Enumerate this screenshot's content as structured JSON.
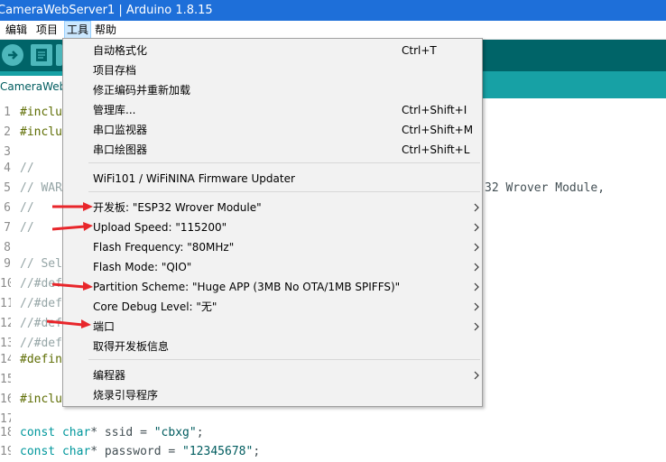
{
  "window": {
    "title": "CameraWebServer1 | Arduino 1.8.15"
  },
  "menubar": {
    "items": [
      "编辑",
      "项目",
      "工具",
      "帮助"
    ]
  },
  "tab": {
    "label": "CameraWebServer"
  },
  "editor": {
    "lines": [
      {
        "n": "1",
        "code": "#inclu"
      },
      {
        "n": "2",
        "code": "#inclu"
      },
      {
        "n": "3",
        "code": ""
      },
      {
        "n": "4",
        "code": "//"
      },
      {
        "n": "5",
        "code": "// WAR"
      },
      {
        "n": "6",
        "code": "//"
      },
      {
        "n": "7",
        "code": "//"
      },
      {
        "n": "8",
        "code": ""
      },
      {
        "n": "9",
        "code": "// Sel"
      },
      {
        "n": "10",
        "code": "//#def"
      },
      {
        "n": "11",
        "code": "//#def"
      },
      {
        "n": "12",
        "code": "//#def"
      },
      {
        "n": "13",
        "code": "//#def"
      },
      {
        "n": "14",
        "code": "#defin"
      },
      {
        "n": "15",
        "code": ""
      },
      {
        "n": "16",
        "code": "#inclu"
      },
      {
        "n": "17",
        "code": ""
      },
      {
        "n": "18",
        "code_parts": [
          "const",
          " ",
          "char",
          "* ssid = ",
          "\"cbxg\"",
          ";"
        ]
      },
      {
        "n": "19",
        "code_parts": [
          "const",
          " ",
          "char",
          "* password = ",
          "\"12345678\"",
          ";"
        ]
      }
    ],
    "overflow_text": "32 Wrover Module,"
  },
  "tools_menu": {
    "items": [
      {
        "label": "自动格式化",
        "shortcut": "Ctrl+T",
        "submenu": false
      },
      {
        "label": "项目存档",
        "shortcut": "",
        "submenu": false
      },
      {
        "label": "修正编码并重新加载",
        "shortcut": "",
        "submenu": false
      },
      {
        "label": "管理库...",
        "shortcut": "Ctrl+Shift+I",
        "submenu": false
      },
      {
        "label": "串口监视器",
        "shortcut": "Ctrl+Shift+M",
        "submenu": false
      },
      {
        "label": "串口绘图器",
        "shortcut": "Ctrl+Shift+L",
        "submenu": false
      },
      {
        "label": "WiFi101 / WiFiNINA Firmware Updater",
        "shortcut": "",
        "submenu": false
      },
      {
        "label": "开发板: \"ESP32 Wrover Module\"",
        "shortcut": "",
        "submenu": true
      },
      {
        "label": "Upload Speed: \"115200\"",
        "shortcut": "",
        "submenu": true
      },
      {
        "label": "Flash Frequency: \"80MHz\"",
        "shortcut": "",
        "submenu": true
      },
      {
        "label": "Flash Mode: \"QIO\"",
        "shortcut": "",
        "submenu": true
      },
      {
        "label": "Partition Scheme: \"Huge APP (3MB No OTA/1MB SPIFFS)\"",
        "shortcut": "",
        "submenu": true
      },
      {
        "label": "Core Debug Level: \"无\"",
        "shortcut": "",
        "submenu": true
      },
      {
        "label": "端口",
        "shortcut": "",
        "submenu": true
      },
      {
        "label": "取得开发板信息",
        "shortcut": "",
        "submenu": false
      },
      {
        "label": "编程器",
        "shortcut": "",
        "submenu": true
      },
      {
        "label": "烧录引导程序",
        "shortcut": "",
        "submenu": false
      }
    ]
  },
  "colors": {
    "titlebar": "#1e6fd9",
    "toolbar": "#006468",
    "tabbar": "#17a1a5",
    "annotation_arrow": "#e8262b"
  },
  "icons": [
    "verify-icon",
    "upload-icon",
    "new-icon",
    "chevron-right-icon",
    "red-arrow-annotation"
  ]
}
